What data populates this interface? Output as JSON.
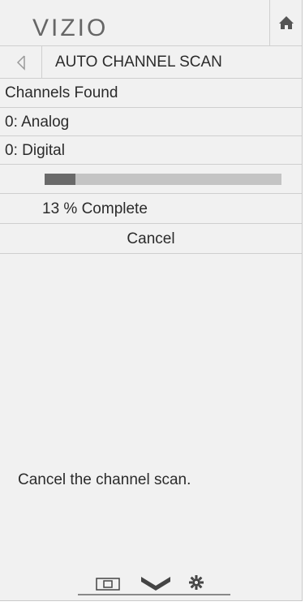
{
  "header": {
    "logo_text": "VIZIO",
    "home_icon": "home-icon"
  },
  "menu": {
    "back_icon": "chevron-left-icon",
    "title": "AUTO CHANNEL SCAN"
  },
  "scan": {
    "found_label": "Channels Found",
    "analog": "0: Analog",
    "digital": "0: Digital",
    "progress_fraction": 0.13,
    "percent_text": "13 % Complete",
    "cancel_label": "Cancel"
  },
  "help": {
    "text": "Cancel the channel scan."
  },
  "footer": {
    "icons": [
      "picture-in-picture-icon",
      "chevron-down-icon",
      "gear-icon"
    ]
  },
  "colors": {
    "panel_bg": "#f1f1f1",
    "divider": "#cfcfcf",
    "progress_track": "#c4c4c4",
    "progress_fill": "#6a6a6a"
  }
}
